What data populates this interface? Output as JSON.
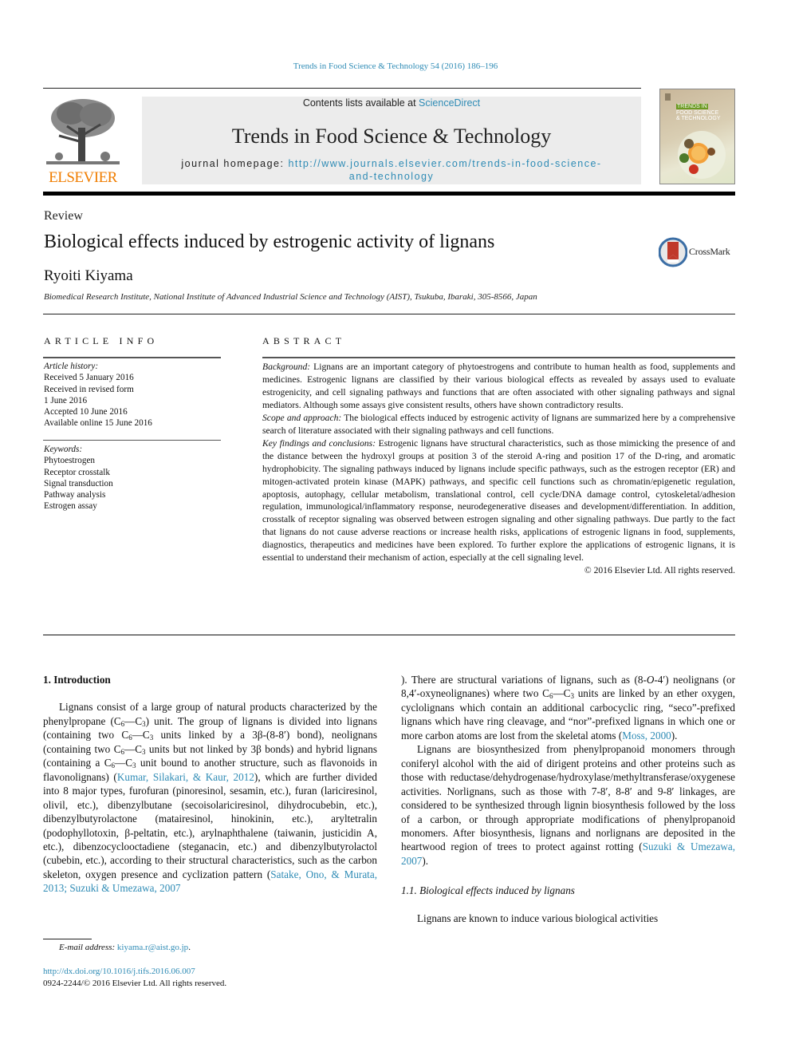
{
  "journal_ref": "Trends in Food Science & Technology 54 (2016) 186–196",
  "masthead": {
    "publisher_logo_text": "ELSEVIER",
    "contents_prefix": "Contents lists available at ",
    "contents_link": "ScienceDirect",
    "journal_name": "Trends in Food Science & Technology",
    "homepage_label": "journal homepage: ",
    "homepage_url_line1": "http://www.journals.elsevier.com/trends-in-food-science-",
    "homepage_url_line2": "and-technology",
    "cover": {
      "line1": "TRENDS IN",
      "line2": "FOOD SCIENCE",
      "line3": "& TECHNOLOGY"
    }
  },
  "article": {
    "type": "Review",
    "title": "Biological effects induced by estrogenic activity of lignans",
    "author": "Ryoiti Kiyama",
    "affiliation": "Biomedical Research Institute, National Institute of Advanced Industrial Science and Technology (AIST), Tsukuba, Ibaraki, 305-8566, Japan",
    "crossmark_label": "CrossMark"
  },
  "article_info": {
    "heading": "ARTICLE INFO",
    "history_label": "Article history:",
    "history": [
      "Received 5 January 2016",
      "Received in revised form",
      "1 June 2016",
      "Accepted 10 June 2016",
      "Available online 15 June 2016"
    ],
    "keywords_label": "Keywords:",
    "keywords": [
      "Phytoestrogen",
      "Receptor crosstalk",
      "Signal transduction",
      "Pathway analysis",
      "Estrogen assay"
    ]
  },
  "abstract": {
    "heading": "ABSTRACT",
    "sections": [
      {
        "label": "Background:",
        "text": " Lignans are an important category of phytoestrogens and contribute to human health as food, supplements and medicines. Estrogenic lignans are classified by their various biological effects as revealed by assays used to evaluate estrogenicity, and cell signaling pathways and functions that are often associated with other signaling pathways and signal mediators. Although some assays give consistent results, others have shown contradictory results."
      },
      {
        "label": "Scope and approach:",
        "text": " The biological effects induced by estrogenic activity of lignans are summarized here by a comprehensive search of literature associated with their signaling pathways and cell functions."
      },
      {
        "label": "Key findings and conclusions:",
        "text": " Estrogenic lignans have structural characteristics, such as those mimicking the presence of and the distance between the hydroxyl groups at position 3 of the steroid A-ring and position 17 of the D-ring, and aromatic hydrophobicity. The signaling pathways induced by lignans include specific pathways, such as the estrogen receptor (ER) and mitogen-activated protein kinase (MAPK) pathways, and specific cell functions such as chromatin/epigenetic regulation, apoptosis, autophagy, cellular metabolism, translational control, cell cycle/DNA damage control, cytoskeletal/adhesion regulation, immunological/inflammatory response, neurodegenerative diseases and development/differentiation. In addition, crosstalk of receptor signaling was observed between estrogen signaling and other signaling pathways. Due partly to the fact that lignans do not cause adverse reactions or increase health risks, applications of estrogenic lignans in food, supplements, diagnostics, therapeutics and medicines have been explored. To further explore the applications of estrogenic lignans, it is essential to understand their mechanism of action, especially at the cell signaling level."
      }
    ],
    "copyright": "© 2016 Elsevier Ltd. All rights reserved."
  },
  "body": {
    "section1_heading": "1.  Introduction",
    "p1": {
      "t1": "Lignans consist of a large group of natural products characterized by the phenylpropane (C",
      "s1": "6",
      "t2": "—C",
      "s2": "3",
      "t3": ") unit. The group of lignans is divided into lignans (containing two C",
      "s3": "6",
      "t4": "—C",
      "s4": "3",
      "t5": " units linked by a 3β-(8-8′) bond), neolignans (containing two C",
      "s5": "6",
      "t6": "—C",
      "s6": "3",
      "t7": " units but not linked by 3β bonds) and hybrid lignans (containing a C",
      "s7": "6",
      "t8": "—C",
      "s8": "3",
      "t9": " unit bound to another structure, such as flavonoids in flavonolignans) (",
      "cite1": "Kumar, Silakari, & Kaur, 2012",
      "t10": "), which are further divided into 8 major types, furofuran (pinoresinol, sesamin, etc.), furan (lariciresinol, olivil, etc.), dibenzylbutane (secoisolariciresinol, dihydrocubebin, etc.), dibenzylbutyrolactone (matairesinol, hinokinin, etc.), aryltetralin (podophyllotoxin, β-peltatin, etc.), arylnaphthalene (taiwanin, justicidin A, etc.), dibenzocyclooctadiene (steganacin, etc.) and dibenzylbutyrolactol (cubebin, etc.), according to their structural characteristics, such as the carbon skeleton, oxygen presence and cyclization pattern (",
      "cite2": "Satake, Ono, & Murata, 2013; Suzuki & Umezawa, 2007",
      "t11": "). There are structural variations of lignans, such as (8-",
      "t11i": "O",
      "t12": "-4′) neolignans (or 8,4′-oxyneolignanes) where two C",
      "s9": "6",
      "t13": "—C",
      "s10": "3",
      "t14": " units are linked by an ether oxygen, cyclolignans which contain an additional carbocyclic ring, “seco”-prefixed lignans which have ring cleavage, and “nor”-prefixed lignans in which one or more carbon atoms are lost from the skeletal atoms (",
      "cite3": "Moss, 2000",
      "t15": ")."
    },
    "p2": {
      "t1": "Lignans are biosynthesized from phenylpropanoid monomers through coniferyl alcohol with the aid of dirigent proteins and other proteins such as those with reductase/dehydrogenase/hydroxylase/methyltransferase/oxygenese activities. Norlignans, such as those with 7-8′, 8-8′ and 9-8′ linkages, are considered to be synthesized through lignin biosynthesis followed by the loss of a carbon, or through appropriate modifications of phenylpropanoid monomers. After biosynthesis, lignans and norlignans are deposited in the heartwood region of trees to protect against rotting (",
      "cite": "Suzuki & Umezawa, 2007",
      "t2": ")."
    },
    "subsection_heading": "1.1.  Biological effects induced by lignans",
    "p3": "Lignans are known to induce various biological activities"
  },
  "footer": {
    "email_label": "E-mail address:",
    "email": "kiyama.r@aist.go.jp",
    "email_suffix": ".",
    "doi": "http://dx.doi.org/10.1016/j.tifs.2016.06.007",
    "issn_line": "0924-2244/© 2016 Elsevier Ltd. All rights reserved."
  }
}
